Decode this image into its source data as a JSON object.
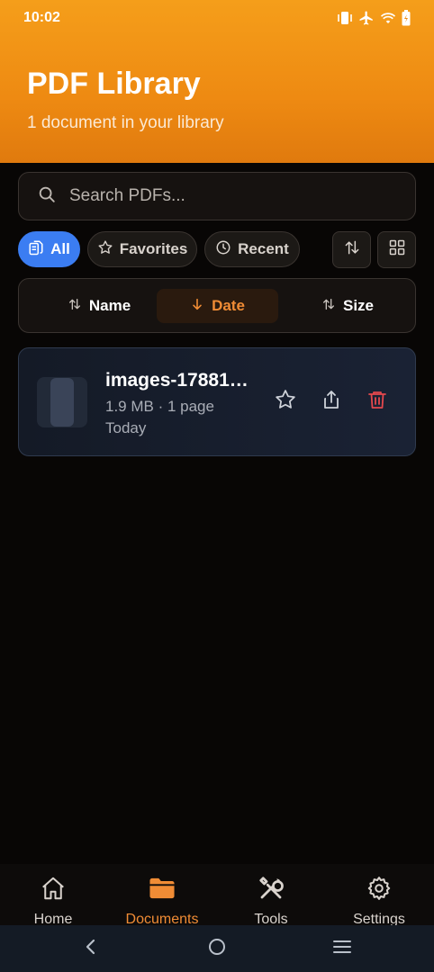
{
  "status_bar": {
    "time": "10:02",
    "icons": [
      "vibrate-icon",
      "airplane-icon",
      "wifi-icon",
      "battery-charging-icon"
    ]
  },
  "header": {
    "title": "PDF Library",
    "subtitle": "1 document in your library"
  },
  "search": {
    "placeholder": "Search PDFs..."
  },
  "filters": {
    "all_label": "All",
    "favorites_label": "Favorites",
    "recent_label": "Recent",
    "active": "All"
  },
  "sort": {
    "name_label": "Name",
    "date_label": "Date",
    "size_label": "Size",
    "active": "Date"
  },
  "documents": [
    {
      "name": "images-17881…",
      "meta": "1.9 MB · 1 page",
      "date": "Today"
    }
  ],
  "bottom_nav": {
    "home_label": "Home",
    "documents_label": "Documents",
    "tools_label": "Tools",
    "settings_label": "Settings",
    "active": "Documents"
  },
  "colors": {
    "header_orange": "#f59e1a",
    "accent_orange": "#f08c35",
    "active_chip_blue": "#3b7df2",
    "delete_red": "#e5484d",
    "background": "#080605"
  }
}
